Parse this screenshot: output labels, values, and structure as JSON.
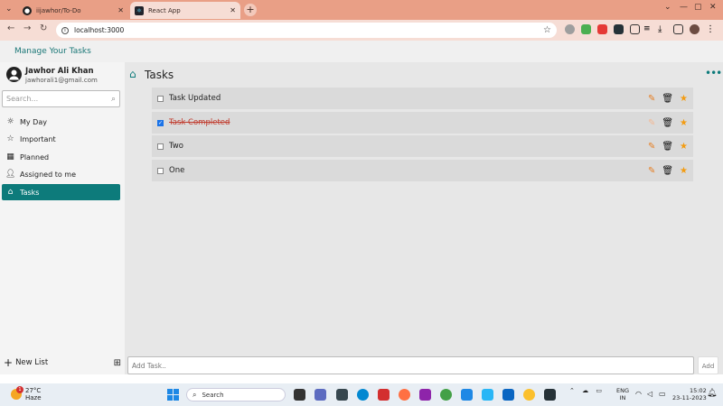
{
  "browser": {
    "tabs": [
      {
        "title": "iijawhor/To-Do",
        "icon": "github-icon"
      },
      {
        "title": "React App",
        "icon": "react-icon"
      }
    ],
    "url": "localhost:3000"
  },
  "app": {
    "title": "Manage Your Tasks",
    "user": {
      "name": "Jawhor Ali Khan",
      "email": "jawhorali1@gmail.com"
    },
    "search_placeholder": "Search...",
    "nav": [
      {
        "label": "My Day",
        "icon": "sun-icon",
        "active": false
      },
      {
        "label": "Important",
        "icon": "star-icon",
        "active": false
      },
      {
        "label": "Planned",
        "icon": "calendar-icon",
        "active": false
      },
      {
        "label": "Assigned to me",
        "icon": "user-icon",
        "active": false
      },
      {
        "label": "Tasks",
        "icon": "home-icon",
        "active": true
      }
    ],
    "new_list_label": "New List",
    "heading": "Tasks",
    "tasks": [
      {
        "text": "Task Updated",
        "completed": false
      },
      {
        "text": "Task Completed",
        "completed": true
      },
      {
        "text": "Two",
        "completed": false
      },
      {
        "text": "One",
        "completed": false
      }
    ],
    "add_task_placeholder": "Add Task..",
    "add_button": "Add"
  },
  "taskbar": {
    "weather": {
      "temp": "27°C",
      "condition": "Haze",
      "badge": "1"
    },
    "search_label": "Search",
    "lang_top": "ENG",
    "lang_bottom": "IN",
    "time": "15:02",
    "date": "23-11-2023"
  },
  "colors": {
    "accent": "#0d7b7b",
    "tabstrip": "#e99f86",
    "star": "#f39c12",
    "pencil": "#e67e22"
  }
}
